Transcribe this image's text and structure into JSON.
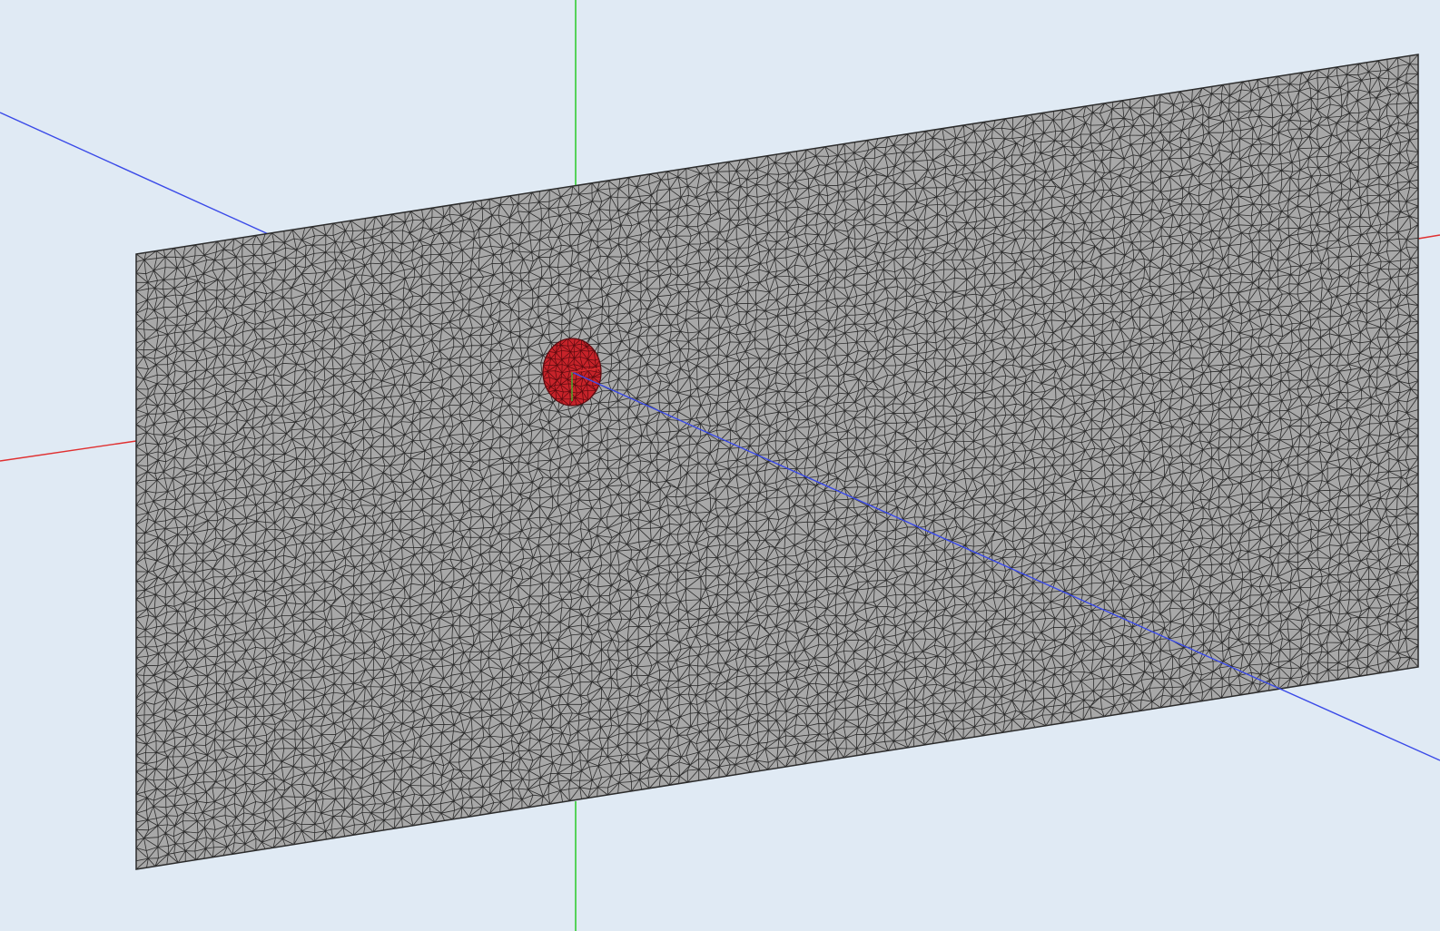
{
  "viewport": {
    "background": "#e0eaf4"
  },
  "axes": {
    "x_color": "#e03030",
    "y_color": "#33cc33",
    "z_color": "#3a4ae8"
  },
  "mesh": {
    "element_type": "triangle",
    "face_color": "#a8a8a8",
    "edge_color": "#2b2b2b",
    "highlight_color": "#c8232a",
    "highlight_edge_color": "#5a0a0e"
  }
}
